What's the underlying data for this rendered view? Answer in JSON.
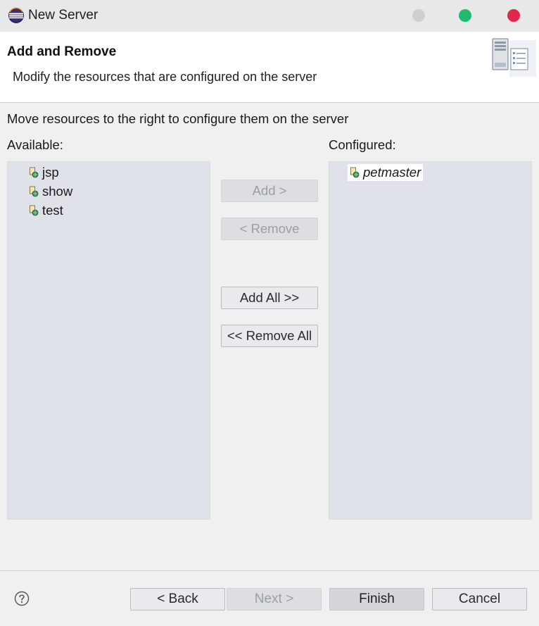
{
  "window": {
    "title": "New Server",
    "app_icon": "eclipse-icon",
    "controls": [
      "minimize",
      "maximize",
      "close"
    ],
    "colors": {
      "minimize": "#cfcfcf",
      "maximize": "#1fbb6f",
      "close": "#e2274d"
    }
  },
  "header": {
    "title": "Add and Remove",
    "description": "Modify the resources that are configured on the server",
    "image_icon": "server-wizard-icon"
  },
  "main": {
    "instruction": "Move resources to the right to configure them on the server",
    "available_label": "Available:",
    "configured_label": "Configured:",
    "available_items": [
      {
        "label": "jsp",
        "icon": "web-module-icon"
      },
      {
        "label": "show",
        "icon": "web-module-icon"
      },
      {
        "label": "test",
        "icon": "web-module-icon"
      }
    ],
    "configured_items": [
      {
        "label": "petmaster",
        "icon": "web-module-icon",
        "selected": true
      }
    ]
  },
  "buttons": {
    "add": "Add >",
    "remove": "< Remove",
    "add_all": "Add All >>",
    "remove_all": "<< Remove All"
  },
  "footer": {
    "help_icon": "help-icon",
    "back": "< Back",
    "next": "Next >",
    "finish": "Finish",
    "cancel": "Cancel"
  }
}
